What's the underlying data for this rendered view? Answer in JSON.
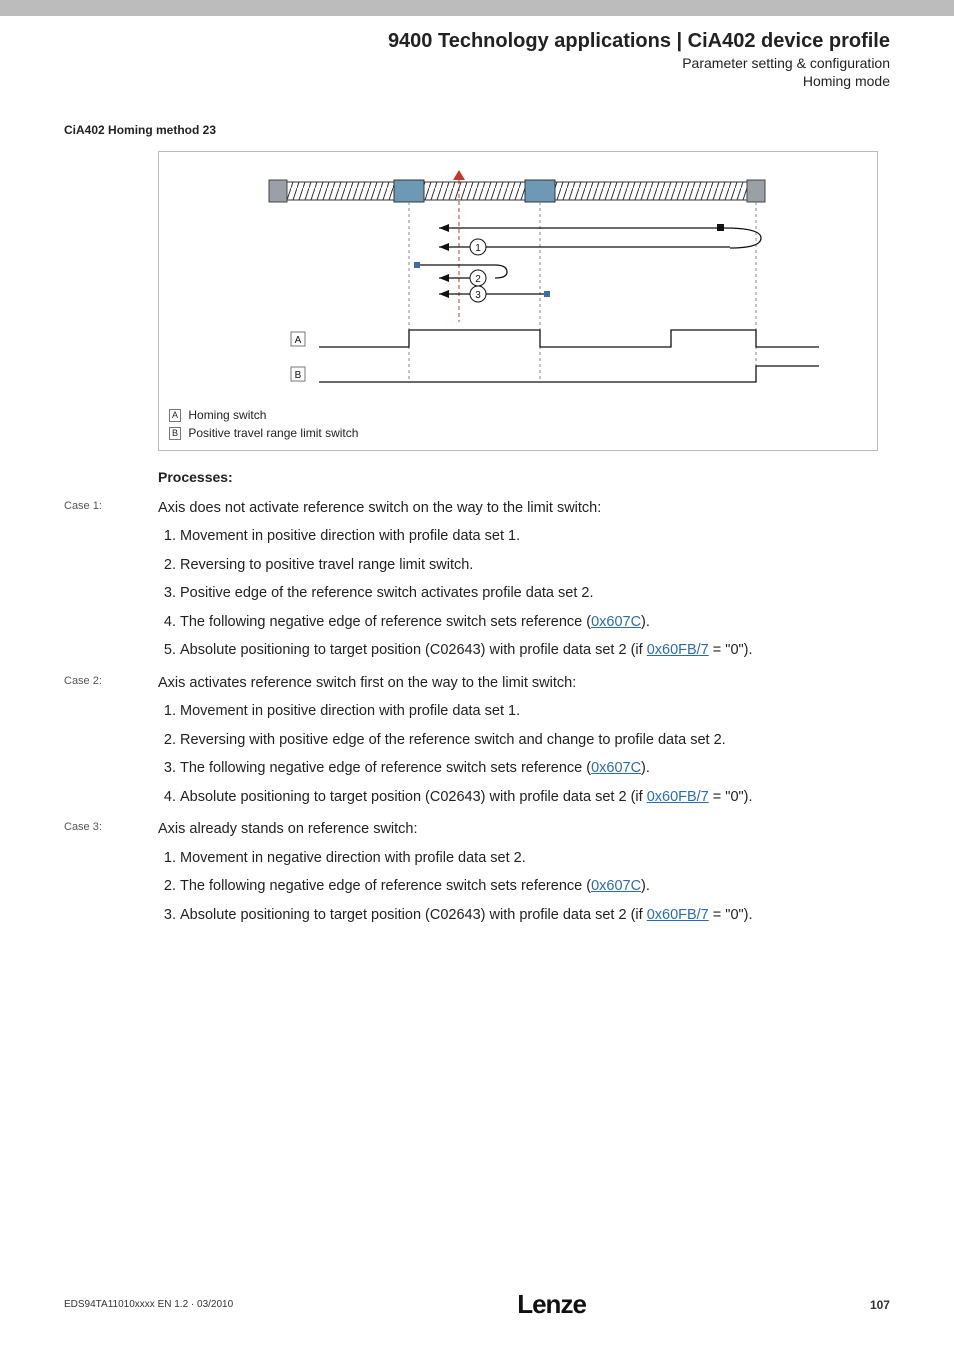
{
  "header": {
    "title": "9400 Technology applications | CiA402 device profile",
    "sub1": "Parameter setting & configuration",
    "sub2": "Homing mode"
  },
  "section_title": "CiA402 Homing method 23",
  "diagram": {
    "legend_a_box": "A",
    "legend_a_text": " Homing switch",
    "legend_b_box": "B",
    "legend_b_text": " Positive travel range limit switch",
    "label_a": "A",
    "label_b": "B",
    "circ1": "1",
    "circ2": "2",
    "circ3": "3"
  },
  "processes_label": "Processes:",
  "cases": [
    {
      "label": "Case 1:",
      "intro": "Axis does not activate reference switch on the way to the limit switch:",
      "items": [
        {
          "text": "Movement in positive direction with profile data set 1."
        },
        {
          "text": "Reversing to positive travel range limit switch."
        },
        {
          "text": "Positive edge of the reference switch activates profile data set 2."
        },
        {
          "pre": "The following negative edge of reference switch sets reference (",
          "link": "0x607C",
          "post": ")."
        },
        {
          "pre": "Absolute positioning to target position (C02643) with profile data set 2 (if ",
          "link": "0x60FB/7",
          "post": " = \"0\")."
        }
      ]
    },
    {
      "label": "Case 2:",
      "intro": "Axis activates reference switch first on the way to the limit switch:",
      "items": [
        {
          "text": "Movement in positive direction with profile data set 1."
        },
        {
          "text": "Reversing with positive edge of the reference switch and change to profile data set 2."
        },
        {
          "pre": "The following negative edge of reference switch sets reference (",
          "link": "0x607C",
          "post": ")."
        },
        {
          "pre": "Absolute positioning to target position (C02643) with profile data set 2 (if ",
          "link": "0x60FB/7",
          "post": " = \"0\")."
        }
      ]
    },
    {
      "label": "Case 3:",
      "intro": "Axis already stands on reference switch:",
      "items": [
        {
          "text": "Movement in negative direction with profile data set 2."
        },
        {
          "pre": "The following negative edge of reference switch sets reference (",
          "link": "0x607C",
          "post": ")."
        },
        {
          "pre": "Absolute positioning to target position (C02643) with profile data set 2 (if ",
          "link": "0x60FB/7",
          "post": " = \"0\")."
        }
      ]
    }
  ],
  "footer": {
    "left": "EDS94TA11010xxxx EN 1.2 · 03/2010",
    "logo": "Lenze",
    "page": "107"
  }
}
